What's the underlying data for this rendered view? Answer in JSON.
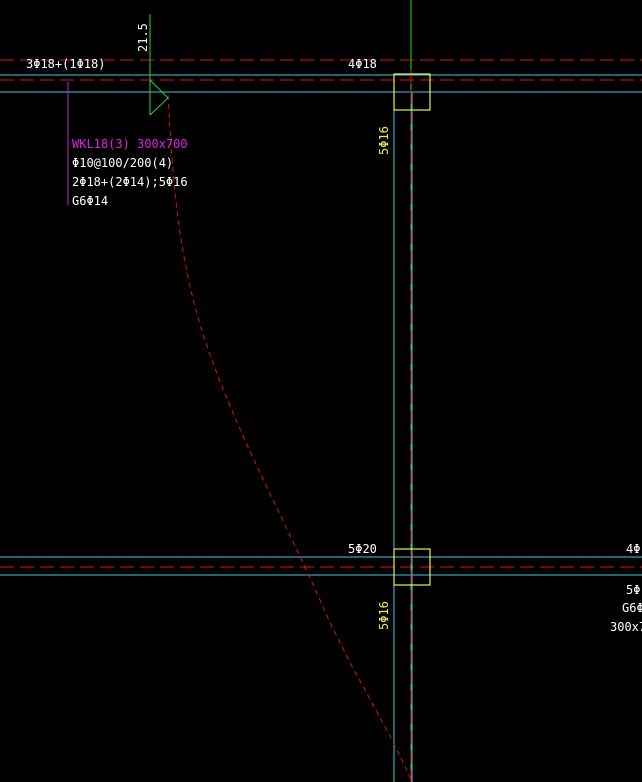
{
  "drawing": {
    "colors": {
      "background": "#000000",
      "axis_line": "#e01010",
      "beam_edge": "#40c8e0",
      "annotation_white": "#ffffff",
      "beam_label_magenta": "#e020e0",
      "column_yellow": "#f0f040",
      "elevation_green": "#30d030",
      "leader_magenta": "#d020d0"
    },
    "top_beam": {
      "left_rebar": "3Φ18+(1Φ18)",
      "mid_rebar": "4Φ18"
    },
    "elevation_mark": {
      "value": "21.5"
    },
    "beam_tag": {
      "name": "WKL18(3)  300x700",
      "stirrup": "Φ10@100/200(4)",
      "main_rebar": "2Φ18+(2Φ14);5Φ16",
      "side_rebar": "G6Φ14"
    },
    "column_rebar": {
      "upper": "5Φ16",
      "lower": "5Φ16"
    },
    "lower_beam": {
      "mid_rebar": "5Φ20",
      "right_rebar": "4Φ",
      "right_tag_line1": "5Φ",
      "right_tag_line2": "G6Φ",
      "right_tag_line3": "300x7"
    }
  }
}
